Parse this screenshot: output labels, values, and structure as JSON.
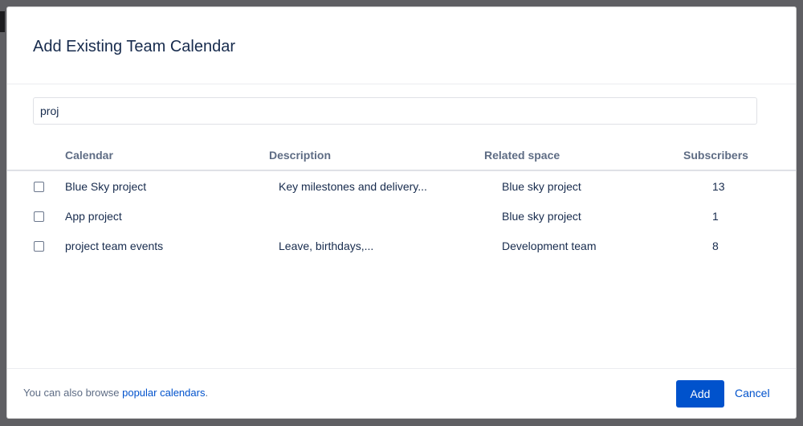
{
  "dialog": {
    "title": "Add Existing Team Calendar",
    "search": {
      "value": "proj",
      "placeholder": ""
    },
    "columns": {
      "calendar": "Calendar",
      "description": "Description",
      "related_space": "Related space",
      "subscribers": "Subscribers"
    },
    "rows": [
      {
        "calendar": "Blue Sky project",
        "description": "Key milestones and delivery...",
        "related_space": "Blue sky project",
        "subscribers": "13",
        "checked": false
      },
      {
        "calendar": "App project",
        "description": "",
        "related_space": "Blue sky project",
        "subscribers": "1",
        "checked": false
      },
      {
        "calendar": "project team events",
        "description": "Leave, birthdays,...",
        "related_space": "Development team",
        "subscribers": "8",
        "checked": false
      }
    ],
    "footer": {
      "text": "You can also browse ",
      "link": "popular calendars",
      "suffix": "."
    },
    "add_label": "Add",
    "cancel_label": "Cancel"
  },
  "colors": {
    "primary": "#0052cc",
    "text": "#172b4d",
    "muted": "#5e6c84",
    "backdrop": "#5f5f63"
  }
}
